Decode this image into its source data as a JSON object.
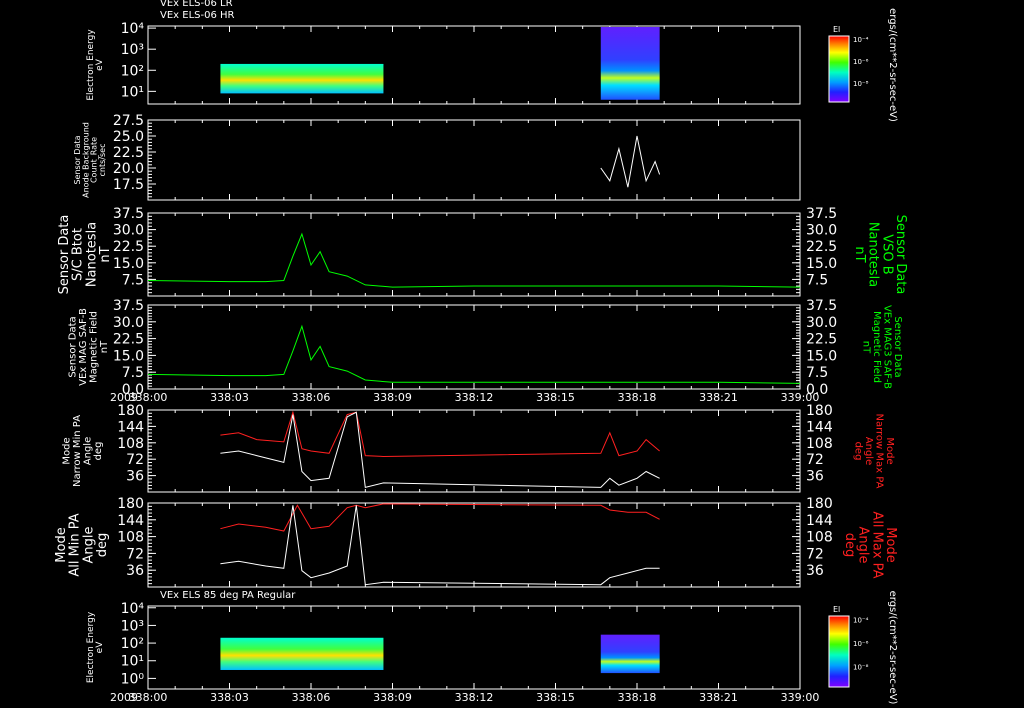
{
  "colors": {
    "background": "#000000",
    "axes": "#ffffff",
    "green_trace": "#00ff00",
    "red_trace": "#ff2020",
    "white_trace": "#ffffff"
  },
  "chart_data": [
    {
      "type": "heatmap",
      "titles": [
        "VEx ELS-06 LR",
        "VEx ELS-06 HR"
      ],
      "ylabel": [
        "Electron Energy",
        "eV"
      ],
      "yticks": [
        "10⁴",
        "10³",
        "10²",
        "10¹"
      ],
      "ytick_values": [
        10000,
        1000,
        100,
        10
      ],
      "log_y": true,
      "colorbar": {
        "title": "El",
        "ticks": [
          "10⁻⁴",
          "10⁻⁶",
          "10⁻⁸"
        ],
        "units": "ergs/(cm**2-sr-sec-eV)"
      },
      "blocks": [
        {
          "x_start": "338:02:40",
          "x_end": "338:08:40",
          "energy_range": [
            8,
            200
          ]
        },
        {
          "x_start": "338:16:40",
          "x_end": "338:18:50",
          "energy_range": [
            4,
            15000
          ]
        }
      ]
    },
    {
      "type": "line",
      "ylabel": [
        "Sensor Data",
        "Anode Background",
        "Count_Rate",
        "cnts/sec"
      ],
      "yticks": [
        "27.5",
        "25.0",
        "22.5",
        "20.0",
        "17.5"
      ],
      "ylim": [
        15,
        27.5
      ],
      "series": [
        {
          "color": "#ffffff",
          "x": [
            "338:16:40",
            "338:17:00",
            "338:17:20",
            "338:17:40",
            "338:18:00",
            "338:18:20",
            "338:18:40",
            "338:18:50"
          ],
          "values": [
            20,
            18,
            23,
            17,
            25,
            18,
            21,
            19
          ]
        }
      ]
    },
    {
      "type": "line",
      "ylabel": [
        "Sensor Data",
        "S/C Btot",
        "Nanotesla",
        "nT"
      ],
      "ylabel_right": [
        "Sensor Data",
        "VSO B",
        "Nanotesla",
        "nT"
      ],
      "yticks": [
        "37.5",
        "30.0",
        "22.5",
        "15.0",
        "7.5"
      ],
      "ylim": [
        0,
        37.5
      ],
      "series": [
        {
          "color": "#00ff00",
          "x": [
            "338:00:00",
            "338:03:00",
            "338:04:20",
            "338:05:00",
            "338:05:20",
            "338:05:40",
            "338:06:00",
            "338:06:20",
            "338:06:40",
            "338:07:20",
            "338:08:00",
            "338:09:00",
            "338:12:00",
            "338:15:00",
            "338:18:00",
            "338:21:00",
            "338:24:00"
          ],
          "values": [
            7,
            6.5,
            6.5,
            7,
            18,
            28,
            14,
            20,
            11,
            9,
            5,
            4,
            4.5,
            4.5,
            4.5,
            4.5,
            4
          ]
        }
      ]
    },
    {
      "type": "line",
      "ylabel": [
        "Sensor Data",
        "VEx MAG SAF-B",
        "Magnetic Field",
        "nT"
      ],
      "ylabel_right": [
        "Sensor Data",
        "VEx MAG3 SAF-B",
        "Magnetic Field",
        "nT"
      ],
      "yticks": [
        "37.5",
        "30.0",
        "22.5",
        "15.0",
        "7.5",
        "0.0"
      ],
      "ylim": [
        0,
        37.5
      ],
      "series": [
        {
          "color": "#00ff00",
          "x": [
            "338:00:00",
            "338:03:00",
            "338:04:20",
            "338:05:00",
            "338:05:20",
            "338:05:40",
            "338:06:00",
            "338:06:20",
            "338:06:40",
            "338:07:20",
            "338:08:00",
            "338:09:00",
            "338:12:00",
            "338:15:00",
            "338:18:00",
            "338:21:00",
            "338:24:00"
          ],
          "values": [
            6.5,
            6,
            6,
            6.5,
            17,
            28,
            13,
            19,
            10,
            8,
            4,
            3,
            3,
            3,
            3,
            3,
            2.5
          ]
        }
      ],
      "xticks": [
        "2009",
        "338:00",
        "338:03",
        "338:06",
        "338:09",
        "338:12",
        "338:15",
        "338:18",
        "338:21",
        "339:00"
      ]
    },
    {
      "type": "line",
      "ylabel": [
        "Mode",
        "Narrow Min PA",
        "Angle",
        "deg"
      ],
      "ylabel_right": [
        "Mode",
        "Narrow Max PA",
        "Angle",
        "deg"
      ],
      "yticks": [
        "180",
        "144",
        "108",
        "72",
        "36"
      ],
      "ylim": [
        0,
        180
      ],
      "series": [
        {
          "color": "#ff2020",
          "x": [
            "338:02:40",
            "338:03:20",
            "338:04:00",
            "338:05:00",
            "338:05:20",
            "338:05:40",
            "338:06:00",
            "338:06:40",
            "338:07:20",
            "338:07:40",
            "338:08:00",
            "338:08:40",
            "338:16:40",
            "338:17:00",
            "338:17:20",
            "338:18:00",
            "338:18:20",
            "338:18:50"
          ],
          "values": [
            125,
            130,
            115,
            110,
            175,
            95,
            90,
            85,
            170,
            175,
            80,
            78,
            85,
            130,
            80,
            90,
            115,
            90
          ]
        },
        {
          "color": "#ffffff",
          "x": [
            "338:02:40",
            "338:03:20",
            "338:04:00",
            "338:05:00",
            "338:05:20",
            "338:05:40",
            "338:06:00",
            "338:06:40",
            "338:07:20",
            "338:07:40",
            "338:08:00",
            "338:08:40",
            "338:16:40",
            "338:17:00",
            "338:17:20",
            "338:18:00",
            "338:18:20",
            "338:18:50"
          ],
          "values": [
            85,
            90,
            80,
            65,
            170,
            45,
            25,
            30,
            165,
            175,
            10,
            20,
            10,
            30,
            15,
            30,
            45,
            30
          ]
        }
      ]
    },
    {
      "type": "line",
      "ylabel": [
        "Mode",
        "All Min PA",
        "Angle",
        "deg"
      ],
      "ylabel_right": [
        "Mode",
        "All Max PA",
        "Angle",
        "deg"
      ],
      "yticks": [
        "180",
        "144",
        "108",
        "72",
        "36"
      ],
      "ylim": [
        0,
        180
      ],
      "series": [
        {
          "color": "#ff2020",
          "x": [
            "338:02:40",
            "338:03:20",
            "338:04:20",
            "338:05:00",
            "338:05:30",
            "338:06:00",
            "338:06:40",
            "338:07:20",
            "338:07:40",
            "338:08:00",
            "338:08:40",
            "338:16:40",
            "338:17:00",
            "338:17:40",
            "338:18:20",
            "338:18:50"
          ],
          "values": [
            125,
            135,
            128,
            120,
            175,
            125,
            130,
            170,
            175,
            170,
            178,
            175,
            165,
            160,
            160,
            145
          ]
        },
        {
          "color": "#ffffff",
          "x": [
            "338:02:40",
            "338:03:20",
            "338:04:20",
            "338:05:00",
            "338:05:20",
            "338:05:40",
            "338:06:00",
            "338:06:40",
            "338:07:20",
            "338:07:40",
            "338:08:00",
            "338:08:40",
            "338:16:40",
            "338:17:00",
            "338:17:40",
            "338:18:20",
            "338:18:50"
          ],
          "values": [
            50,
            55,
            45,
            40,
            175,
            35,
            20,
            30,
            45,
            175,
            5,
            10,
            5,
            20,
            30,
            40,
            40
          ]
        }
      ]
    },
    {
      "type": "heatmap",
      "titles": [
        "VEx ELS 85 deg PA Regular"
      ],
      "ylabel": [
        "Electron Energy",
        "eV"
      ],
      "yticks": [
        "10⁴",
        "10³",
        "10²",
        "10¹",
        "10⁰"
      ],
      "ytick_values": [
        10000,
        1000,
        100,
        10,
        1
      ],
      "log_y": true,
      "colorbar": {
        "title": "El",
        "ticks": [
          "10⁻⁴",
          "10⁻⁶",
          "10⁻⁸"
        ],
        "units": "ergs/(cm**2-sr-sec-eV)"
      },
      "blocks": [
        {
          "x_start": "338:02:40",
          "x_end": "338:08:40",
          "energy_range": [
            3,
            200
          ]
        },
        {
          "x_start": "338:16:40",
          "x_end": "338:18:50",
          "energy_range": [
            2,
            300
          ]
        }
      ],
      "xticks": [
        "2009",
        "338:00",
        "338:03",
        "338:06",
        "338:09",
        "338:12",
        "338:15",
        "338:18",
        "338:21",
        "339:00"
      ]
    }
  ]
}
